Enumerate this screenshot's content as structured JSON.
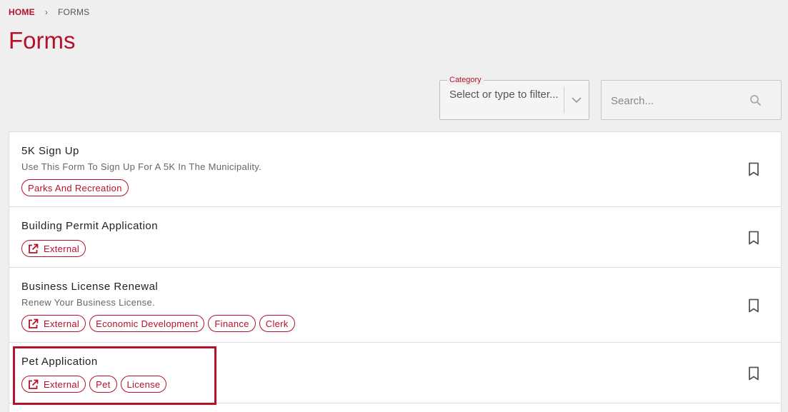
{
  "breadcrumb": {
    "home": "HOME",
    "separator": "›",
    "current": "FORMS"
  },
  "page": {
    "title": "Forms"
  },
  "filters": {
    "category": {
      "label": "Category",
      "placeholder": "Select or type to filter...",
      "icon": "chevron-down-icon"
    },
    "search": {
      "placeholder": "Search...",
      "icon": "search-icon"
    }
  },
  "forms": [
    {
      "title": "5K Sign Up",
      "description": "Use This Form To Sign Up For A 5K In The Municipality.",
      "tags": [
        "Parks And Recreation"
      ],
      "external": false
    },
    {
      "title": "Building Permit Application",
      "description": "",
      "tags": [
        "External"
      ],
      "external": true
    },
    {
      "title": "Business License Renewal",
      "description": "Renew Your Business License.",
      "tags": [
        "External",
        "Economic Development",
        "Finance",
        "Clerk"
      ],
      "external": true
    },
    {
      "title": "Pet Application",
      "description": "",
      "tags": [
        "External",
        "Pet",
        "License"
      ],
      "external": true
    }
  ],
  "colors": {
    "accent": "#b5112b",
    "background": "#efefef",
    "card": "#ffffff"
  }
}
